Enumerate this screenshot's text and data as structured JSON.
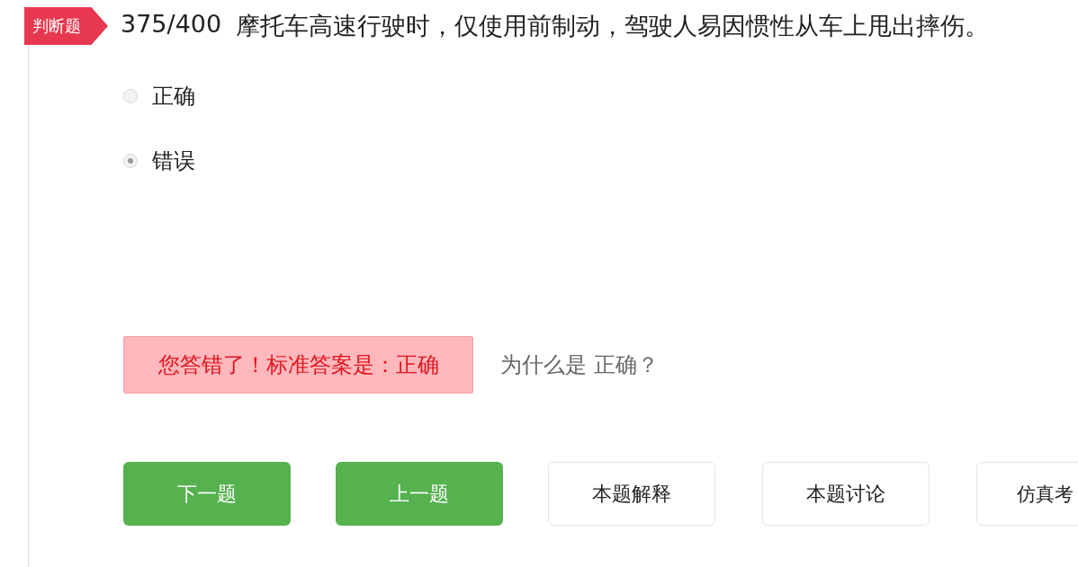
{
  "question": {
    "type_tag": "判断题",
    "progress": "375/400",
    "text": "摩托车高速行驶时，仅使用前制动，驾驶人易因惯性从车上甩出摔伤。"
  },
  "options": [
    {
      "label": "正确",
      "selected": false
    },
    {
      "label": "错误",
      "selected": true
    }
  ],
  "feedback": {
    "kind": "wrong",
    "message": "您答错了！标准答案是：正确",
    "why_link": "为什么是 正确？"
  },
  "buttons": [
    {
      "label": "下一题",
      "kind": "primary"
    },
    {
      "label": "上一题",
      "kind": "primary"
    },
    {
      "label": "本题解释",
      "kind": "outline"
    },
    {
      "label": "本题讨论",
      "kind": "outline"
    },
    {
      "label": "仿真考",
      "kind": "outline"
    }
  ]
}
